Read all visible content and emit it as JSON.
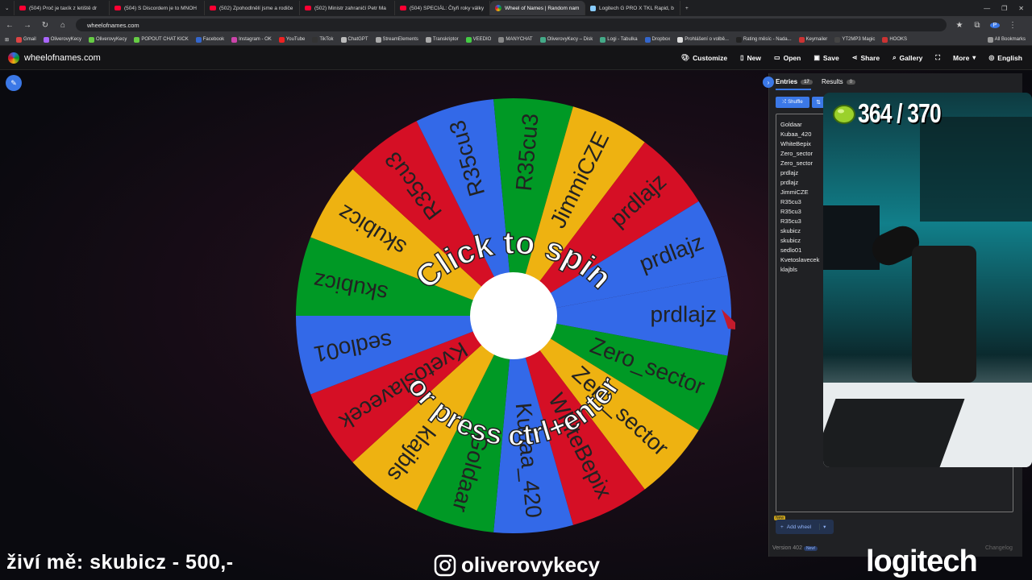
{
  "browser": {
    "tabs": [
      {
        "label": "(504) Proč je taxík z letiště dr"
      },
      {
        "label": "(504) S Discordem je to MNOH"
      },
      {
        "label": "(502) Zpohodlnělí jsme a rodiče"
      },
      {
        "label": "(502) Ministr zahraničí Petr Ma"
      },
      {
        "label": "(504) SPECIÁL: Čtyři roky války"
      },
      {
        "label": "Wheel of Names | Random nam"
      },
      {
        "label": "Logitech G PRO X TKL Rapid, b"
      }
    ],
    "url": "wheelofnames.com",
    "bookmarks": [
      "Gmail",
      "OliverovyKecy",
      "OliverovyKecy",
      "POPOUT CHAT KICK",
      "Facebook",
      "Instagram - OK",
      "YouTube",
      "TikTok",
      "ChatGPT",
      "StreamElements",
      "Transkriptor",
      "VEEDIO",
      "MANYCHAT",
      "OliverovyKecy – Disk",
      "Logi - Tabulka",
      "Dropbox",
      "Prohlášení o volbě...",
      "Rating měsíc - Nada...",
      "Keymailer",
      "YT2MP3 Magic",
      "HOOKS"
    ],
    "all_bookmarks": "All Bookmarks"
  },
  "site": {
    "name": "wheelofnames.com",
    "menu": [
      {
        "label": "Customize",
        "icon": "palette-icon"
      },
      {
        "label": "New",
        "icon": "new-file-icon"
      },
      {
        "label": "Open",
        "icon": "folder-icon"
      },
      {
        "label": "Save",
        "icon": "save-icon"
      },
      {
        "label": "Share",
        "icon": "share-icon"
      },
      {
        "label": "Gallery",
        "icon": "search-icon"
      },
      {
        "label": "",
        "icon": "fullscreen-icon"
      },
      {
        "label": "More",
        "icon": "chevron-down-icon"
      },
      {
        "label": "English",
        "icon": "globe-icon"
      }
    ]
  },
  "wheel": {
    "top_text": "Click to spin",
    "bottom_text": "or press ctrl+enter",
    "colors": [
      "#3369e8",
      "#009925",
      "#eeb211",
      "#d50f25"
    ],
    "segments": [
      "prdlajz",
      "Zero_sector",
      "Zero_sector",
      "WhiteBepix",
      "Kubaa_420",
      "Goldaar",
      "klajbls",
      "Kvetoslavecek",
      "sedlo01",
      "skubicz",
      "skubicz",
      "R35cu3",
      "R35cu3",
      "R35cu3",
      "JimmiCZE",
      "prdlajz",
      "prdlajz"
    ]
  },
  "panel": {
    "entries_tab": "Entries",
    "entries_count": "17",
    "results_tab": "Results",
    "results_count": "0",
    "shuffle": "Shuffle",
    "entries": [
      "Goldaar",
      "Kubaa_420",
      "WhiteBepix",
      "Zero_sector",
      "Zero_sector",
      "prdlajz",
      "prdlajz",
      "JimmiCZE",
      "R35cu3",
      "R35cu3",
      "R35cu3",
      "skubicz",
      "skubicz",
      "sedlo01",
      "Kvetoslavecek",
      "klajbls"
    ],
    "new_badge": "New",
    "add_wheel": "Add wheel",
    "version": "Version 402",
    "version_badge": "New!",
    "changelog": "Changelog"
  },
  "stream": {
    "points": "364 / 370",
    "ticker": "živí mě: skubicz - 500,-",
    "instagram": "oliverovykecy",
    "sponsor": "logitech"
  }
}
